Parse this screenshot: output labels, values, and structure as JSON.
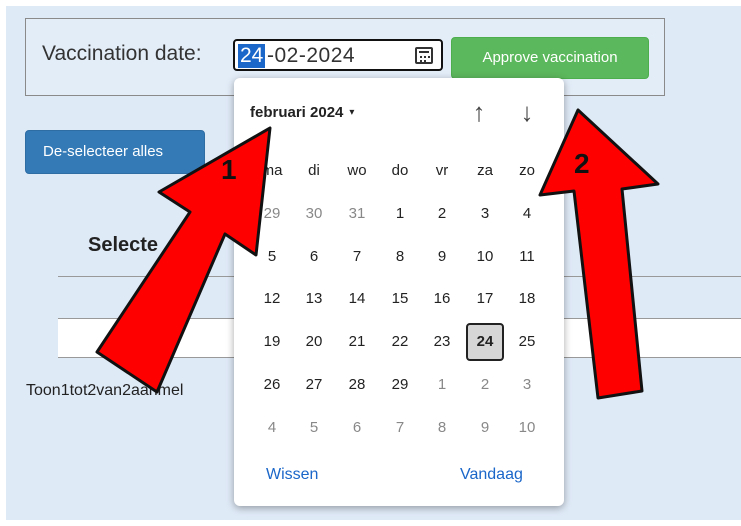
{
  "vaccination": {
    "label": "Vaccination date:",
    "date_day": "24",
    "date_rest": "-02-2024",
    "approve_label": "Approve vaccination"
  },
  "deselect_label": "De-selecteer alles",
  "selection_heading": "Selecte",
  "footer_text": "Toon1tot2van2aanmel",
  "picker": {
    "month_label": "februari 2024",
    "caret": "▾",
    "nav_up": "↑",
    "nav_down": "↓",
    "weekdays": [
      "ma",
      "di",
      "wo",
      "do",
      "vr",
      "za",
      "zo"
    ],
    "weeks": [
      [
        "29",
        "30",
        "31",
        "1",
        "2",
        "3",
        "4"
      ],
      [
        "5",
        "6",
        "7",
        "8",
        "9",
        "10",
        "11"
      ],
      [
        "12",
        "13",
        "14",
        "15",
        "16",
        "17",
        "18"
      ],
      [
        "19",
        "20",
        "21",
        "22",
        "23",
        "24",
        "25"
      ],
      [
        "26",
        "27",
        "28",
        "29",
        "1",
        "2",
        "3"
      ],
      [
        "4",
        "5",
        "6",
        "7",
        "8",
        "9",
        "10"
      ]
    ],
    "selected_day": "24",
    "clear_label": "Wissen",
    "today_label": "Vandaag"
  },
  "annotations": {
    "arrow1_label": "1",
    "arrow2_label": "2",
    "arrow_color": "#ff0000"
  },
  "colors": {
    "approve_green": "#5cb85c",
    "deselect_blue": "#337ab7",
    "link_blue": "#1a66c9",
    "background": "#dfeaf7"
  }
}
